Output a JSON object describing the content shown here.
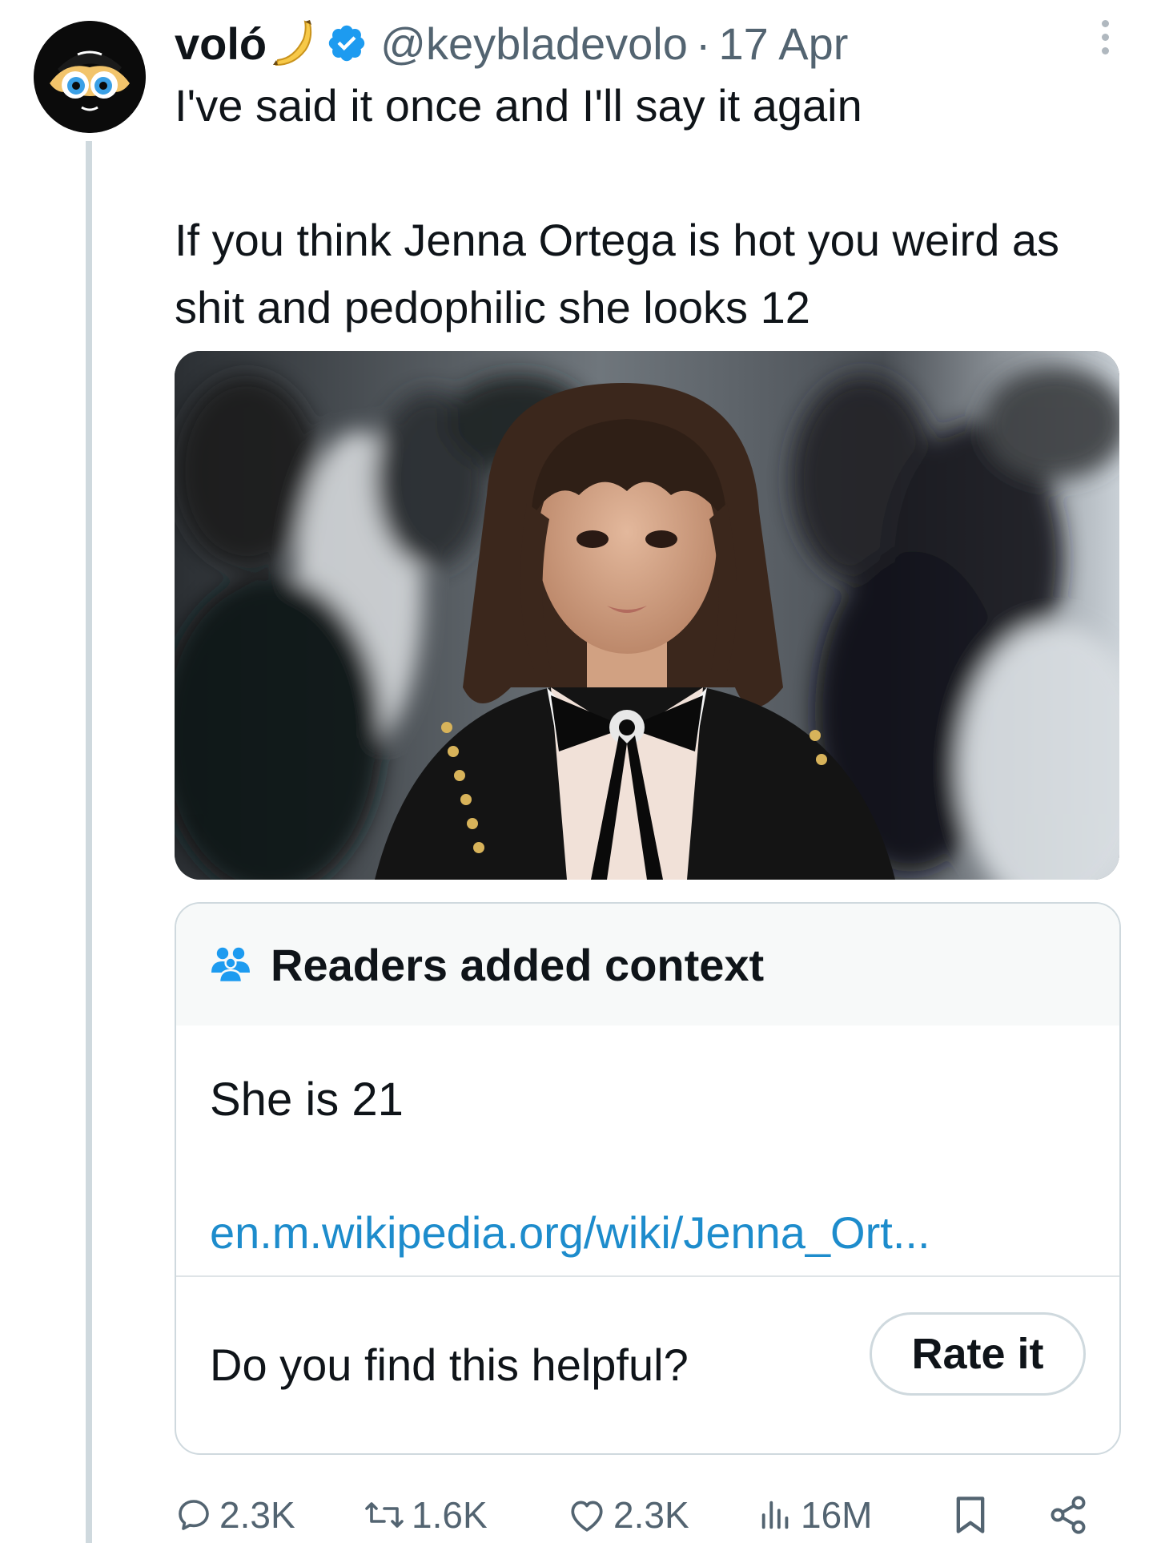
{
  "tweet": {
    "display_name": "voló",
    "handle": "@keybladevolo",
    "separator": "·",
    "date": "17 Apr",
    "text_line_1": "I've said it once and I'll say it again",
    "text_line_2": "If you think Jenna Ortega is hot you weird as shit and pedophilic she looks 12",
    "media_alt": "Photo of Jenna Ortega on a red carpet with photographers in the background",
    "verified_color": "#1d9bf0"
  },
  "community_note": {
    "title": "Readers added context",
    "text": "She is 21",
    "link": "en.m.wikipedia.org/wiki/Jenna_Ort...",
    "question": "Do you find this helpful?",
    "rate_button": "Rate it",
    "accent_color": "#1d9bf0"
  },
  "actions": {
    "replies": "2.3K",
    "reposts": "1.6K",
    "likes": "2.3K",
    "views": "16M"
  },
  "icons": {
    "more": "more-dots-icon",
    "verified": "verified-badge-icon",
    "emoji": "banana-emoji-icon",
    "note": "people-icon",
    "reply": "reply-bubble-icon",
    "repost": "repost-arrows-icon",
    "like": "heart-icon",
    "views": "bar-chart-icon",
    "bookmark": "bookmark-icon",
    "share": "share-icon"
  }
}
